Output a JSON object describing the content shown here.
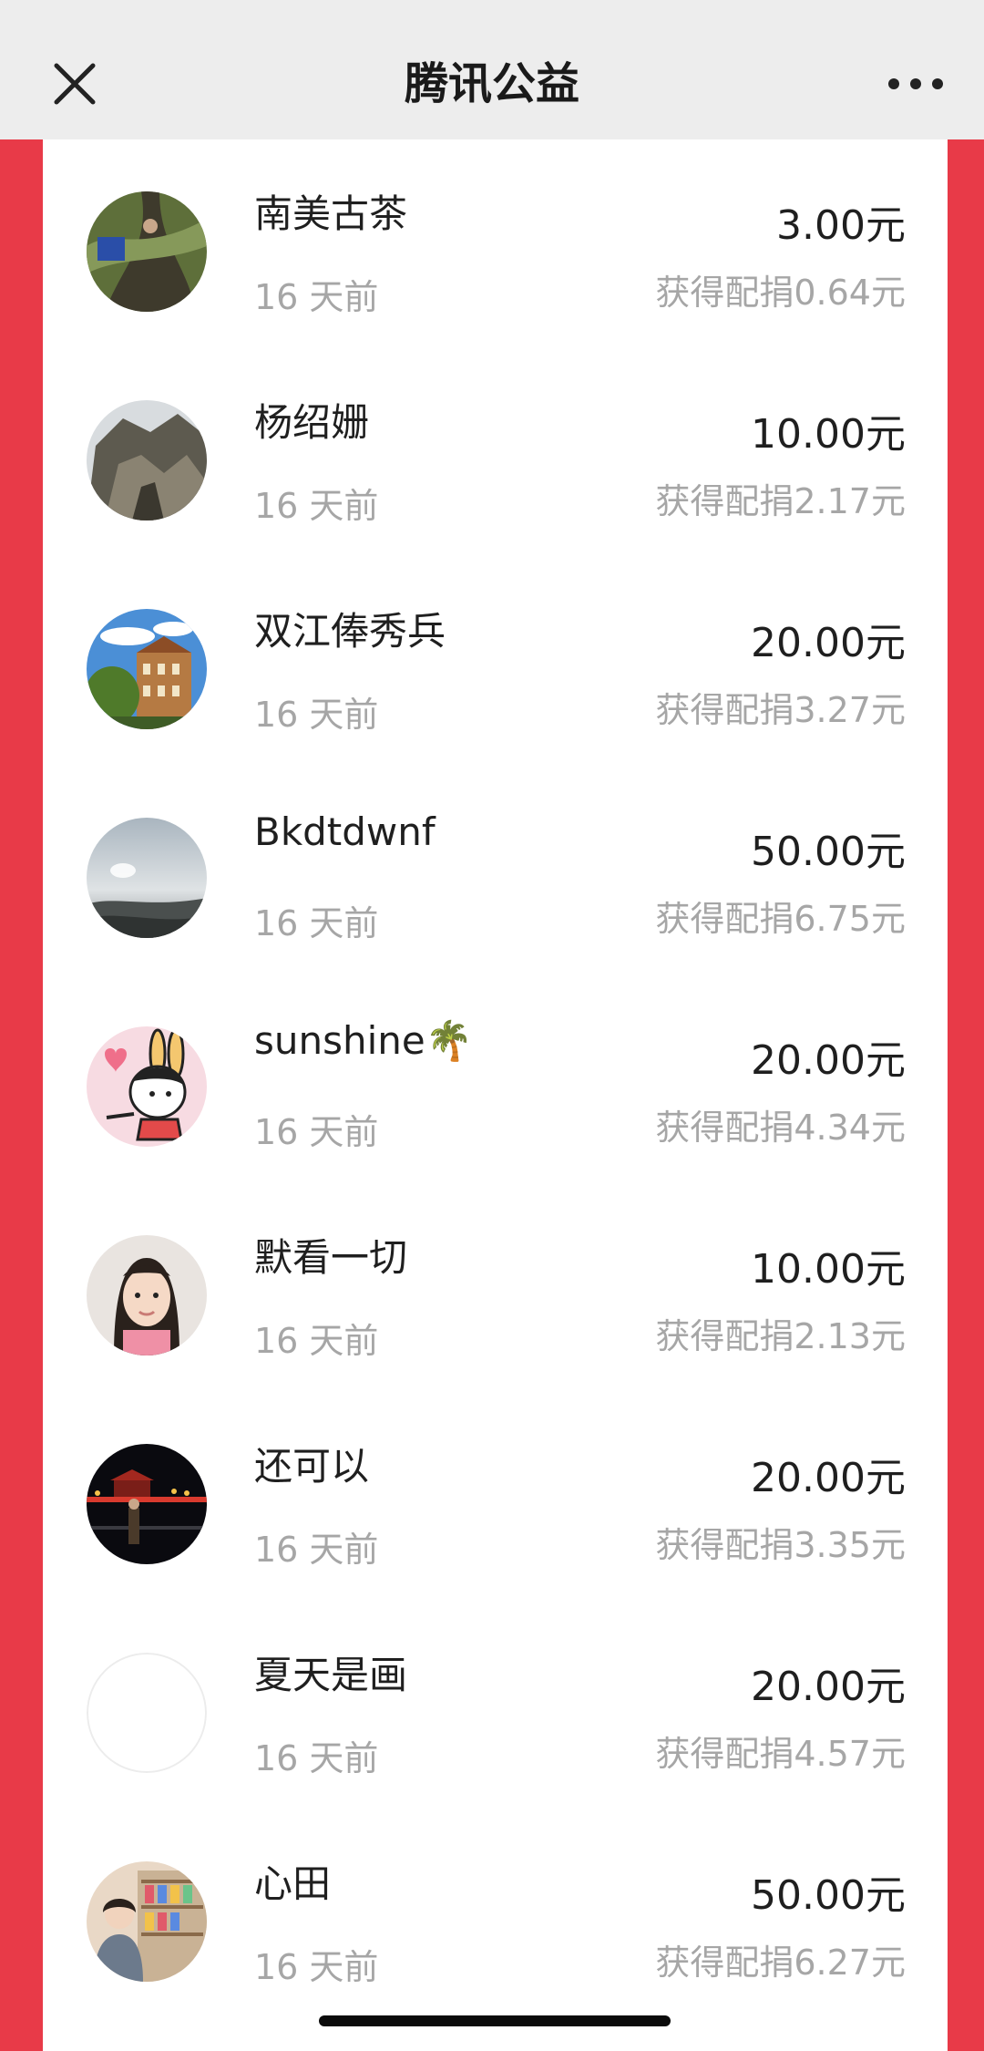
{
  "header": {
    "title": "腾讯公益",
    "close_icon": "close-icon",
    "more_icon": "more-dots-icon"
  },
  "colors": {
    "accent": "#e83a48",
    "header_bg": "#ededed",
    "text_primary": "#1f1f1f",
    "text_secondary": "#a6a6a6"
  },
  "donations": [
    {
      "name": "南美古茶",
      "time": "16 天前",
      "amount": "3.00元",
      "match": "获得配捐0.64元"
    },
    {
      "name": "杨绍姗",
      "time": "16 天前",
      "amount": "10.00元",
      "match": "获得配捐2.17元"
    },
    {
      "name": "双江俸秀兵",
      "time": "16 天前",
      "amount": "20.00元",
      "match": "获得配捐3.27元"
    },
    {
      "name": "Bkdtdwnf",
      "time": "16 天前",
      "amount": "50.00元",
      "match": "获得配捐6.75元"
    },
    {
      "name": "sunshine🌴",
      "time": "16 天前",
      "amount": "20.00元",
      "match": "获得配捐4.34元"
    },
    {
      "name": "默看一切",
      "time": "16 天前",
      "amount": "10.00元",
      "match": "获得配捐2.13元"
    },
    {
      "name": "还可以",
      "time": "16 天前",
      "amount": "20.00元",
      "match": "获得配捐3.35元"
    },
    {
      "name": "夏天是画",
      "time": "16 天前",
      "amount": "20.00元",
      "match": "获得配捐4.57元"
    },
    {
      "name": "心田",
      "time": "16 天前",
      "amount": "50.00元",
      "match": "获得配捐6.27元"
    }
  ]
}
